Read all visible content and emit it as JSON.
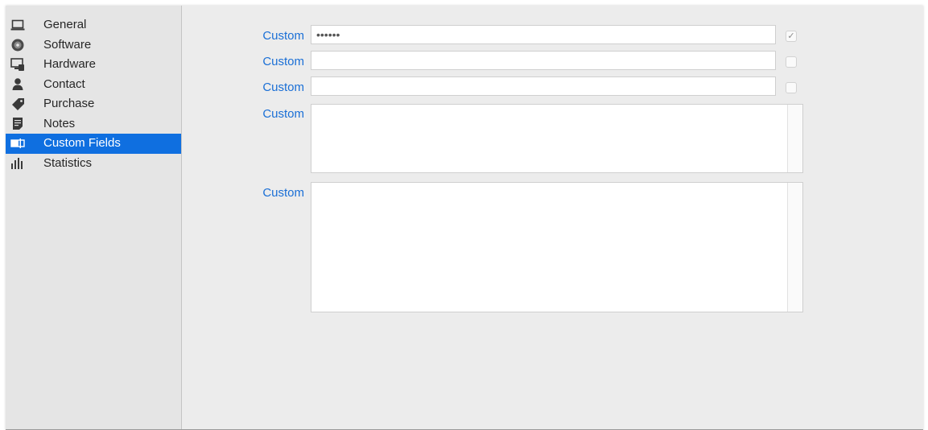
{
  "sidebar": {
    "items": [
      {
        "label": "General",
        "icon": "laptop-icon"
      },
      {
        "label": "Software",
        "icon": "disc-icon"
      },
      {
        "label": "Hardware",
        "icon": "monitor-icon"
      },
      {
        "label": "Contact",
        "icon": "person-icon"
      },
      {
        "label": "Purchase",
        "icon": "tag-icon"
      },
      {
        "label": "Notes",
        "icon": "notes-icon"
      },
      {
        "label": "Custom Fields",
        "icon": "custom-fields-icon",
        "selected": true
      },
      {
        "label": "Statistics",
        "icon": "bar-chart-icon"
      }
    ]
  },
  "fields": [
    {
      "label": "Custom",
      "type": "text",
      "value": "••••••",
      "checked": true
    },
    {
      "label": "Custom",
      "type": "text",
      "value": "",
      "checked": false
    },
    {
      "label": "Custom",
      "type": "text",
      "value": "",
      "checked": false
    },
    {
      "label": "Custom",
      "type": "textarea",
      "value": ""
    },
    {
      "label": "Custom",
      "type": "textarea",
      "value": ""
    }
  ],
  "colors": {
    "accent": "#0f6fe0",
    "label_blue": "#1a6fd6",
    "background": "#ececec",
    "sidebar": "#e5e5e5"
  }
}
